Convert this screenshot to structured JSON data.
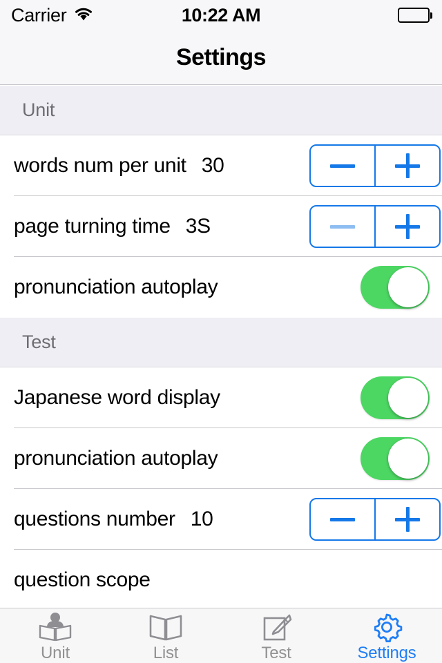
{
  "statusbar": {
    "carrier": "Carrier",
    "wifi_icon": "wifi-icon",
    "time": "10:22 AM",
    "battery_icon": "battery-full-icon"
  },
  "navbar": {
    "title": "Settings"
  },
  "colors": {
    "accent_blue": "#1578e8",
    "accent_blue_disabled": "#8dbdf1",
    "toggle_on_green": "#4cd763",
    "tab_active_blue": "#1f7ef5",
    "section_header_bg": "#efeef4",
    "separator": "#c8c7cc",
    "section_title_text": "#6d6d72",
    "tab_inactive_text": "#929292"
  },
  "sections": [
    {
      "header": "Unit",
      "rows": [
        {
          "label": "words num per unit",
          "value": "30",
          "control": "stepper",
          "minus_label": "−",
          "plus_label": "+",
          "minus_disabled": false
        },
        {
          "label": "page turning time",
          "value": "3S",
          "control": "stepper",
          "minus_label": "−",
          "plus_label": "+",
          "minus_disabled": true
        },
        {
          "label": "pronunciation autoplay",
          "value": "",
          "control": "toggle",
          "toggle_on": true
        }
      ]
    },
    {
      "header": "Test",
      "rows": [
        {
          "label": "Japanese word display",
          "value": "",
          "control": "toggle",
          "toggle_on": true
        },
        {
          "label": "pronunciation autoplay",
          "value": "",
          "control": "toggle",
          "toggle_on": true
        },
        {
          "label": "questions number",
          "value": "10",
          "control": "stepper",
          "minus_label": "−",
          "plus_label": "+",
          "minus_disabled": false
        },
        {
          "label": "question scope",
          "value": "",
          "control": "none",
          "clipped": true
        }
      ]
    }
  ],
  "tabbar": {
    "items": [
      {
        "label": "Unit",
        "icon": "person-reading-book-icon",
        "active": false
      },
      {
        "label": "List",
        "icon": "open-book-icon",
        "active": false
      },
      {
        "label": "Test",
        "icon": "note-pencil-icon",
        "active": false
      },
      {
        "label": "Settings",
        "icon": "gear-icon",
        "active": true
      }
    ]
  }
}
